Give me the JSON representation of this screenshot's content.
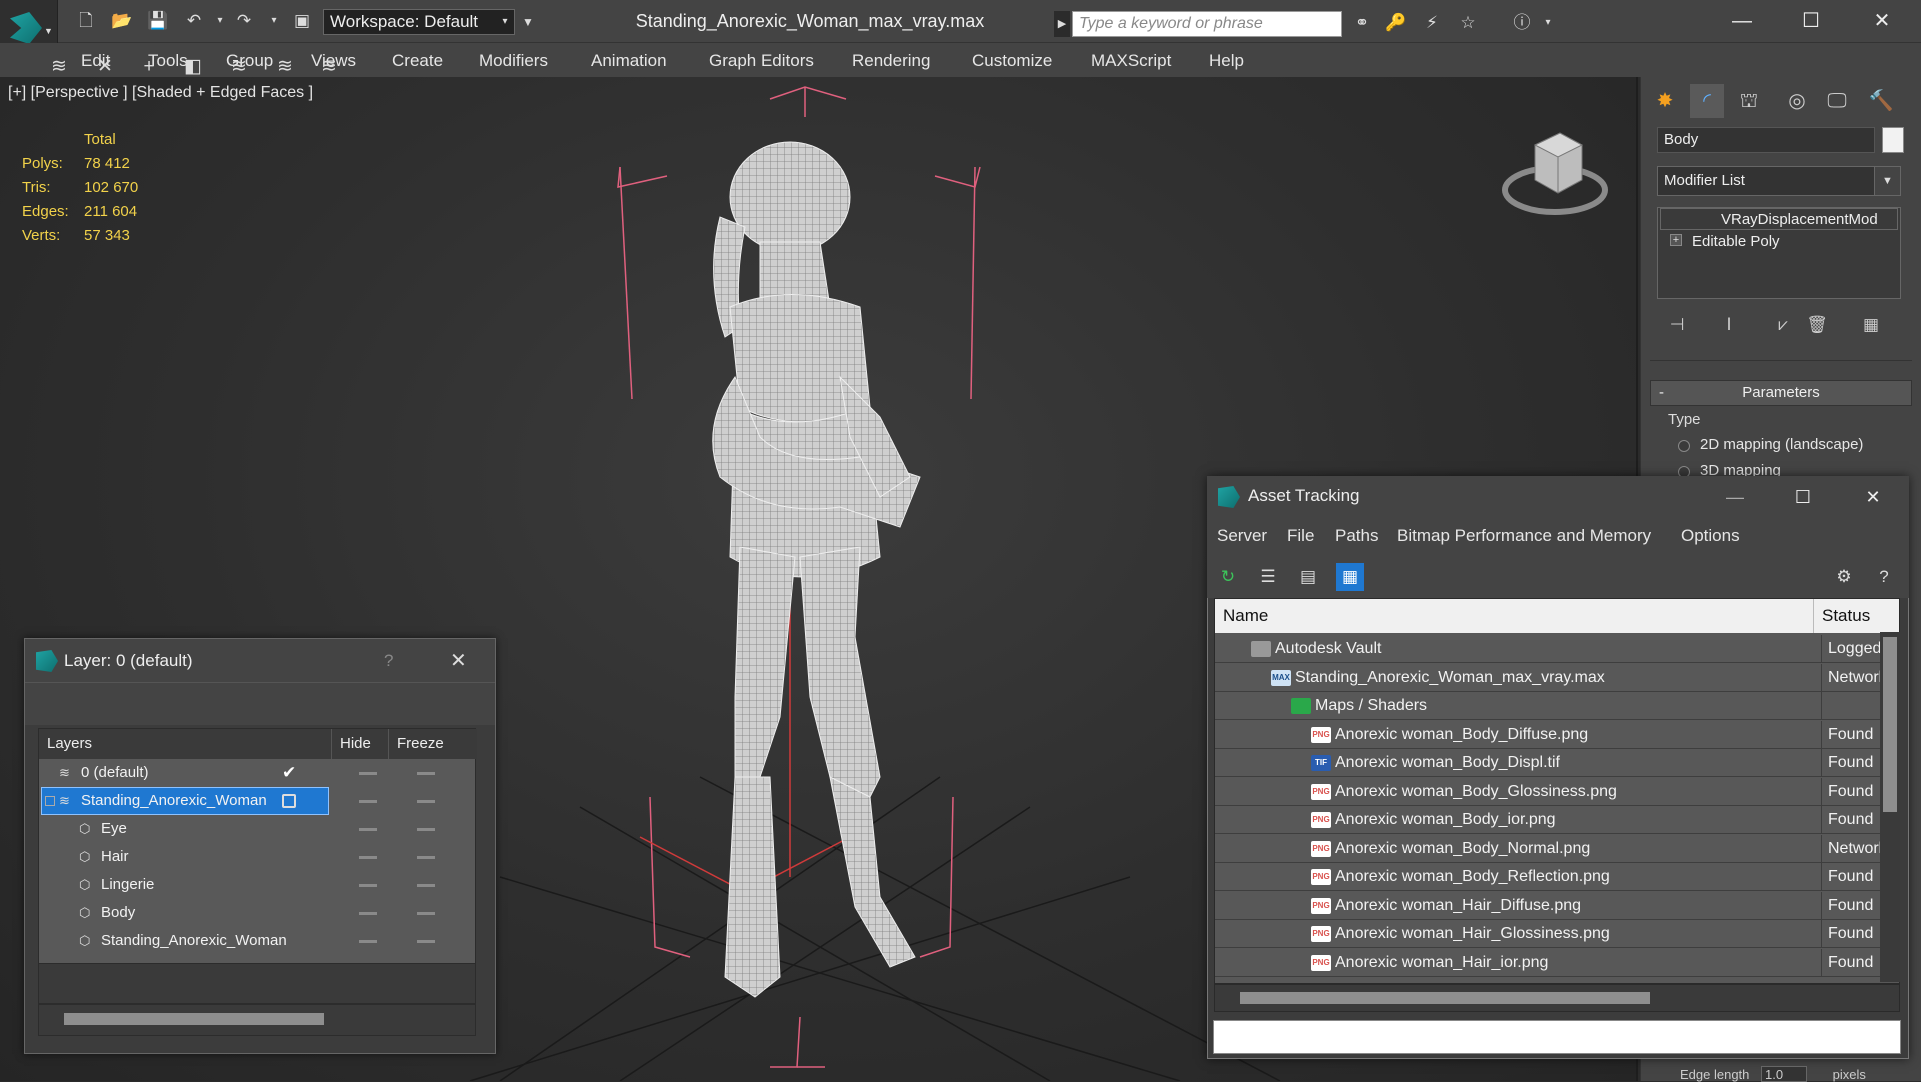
{
  "titlebar": {
    "workspace_label": "Workspace: Default",
    "document_title": "Standing_Anorexic_Woman_max_vray.max",
    "search_placeholder": "Type a keyword or phrase"
  },
  "menu": [
    "Edit",
    "Tools",
    "Group",
    "Views",
    "Create",
    "Modifiers",
    "Animation",
    "Graph Editors",
    "Rendering",
    "Customize",
    "MAXScript",
    "Help"
  ],
  "viewport": {
    "label": "[+] [Perspective ] [Shaded + Edged Faces ]",
    "stats": {
      "total_label": "Total",
      "rows": [
        {
          "label": "Polys:",
          "value": "78 412"
        },
        {
          "label": "Tris:",
          "value": "102 670"
        },
        {
          "label": "Edges:",
          "value": "211 604"
        },
        {
          "label": "Verts:",
          "value": "57 343"
        }
      ]
    }
  },
  "command_panel": {
    "object_name": "Body",
    "modifier_list_label": "Modifier List",
    "stack": [
      "VRayDisplacementMod",
      "Editable Poly"
    ],
    "rollout_title": "Parameters",
    "rollout_toggle": "-",
    "type_label": "Type",
    "type_options": [
      "2D mapping (landscape)",
      "3D mapping"
    ],
    "bottom_label": "Edge length",
    "bottom_value": "1.0",
    "bottom_unit": "pixels"
  },
  "layer_dialog": {
    "title": "Layer: 0 (default)",
    "help": "?",
    "columns": [
      "Layers",
      "Hide",
      "Freeze"
    ],
    "rows": [
      {
        "name": "0 (default)",
        "indent": 1,
        "type": "layer",
        "selected": false
      },
      {
        "name": "Standing_Anorexic_Woman",
        "indent": 1,
        "type": "layer",
        "selected": true
      },
      {
        "name": "Eye",
        "indent": 2,
        "type": "object",
        "selected": false
      },
      {
        "name": "Hair",
        "indent": 2,
        "type": "object",
        "selected": false
      },
      {
        "name": "Lingerie",
        "indent": 2,
        "type": "object",
        "selected": false
      },
      {
        "name": "Body",
        "indent": 2,
        "type": "object",
        "selected": false
      },
      {
        "name": "Standing_Anorexic_Woman",
        "indent": 2,
        "type": "object",
        "selected": false
      }
    ]
  },
  "asset_tracking": {
    "title": "Asset Tracking",
    "menu": [
      "Server",
      "File",
      "Paths",
      "Bitmap Performance and Memory",
      "Options"
    ],
    "columns": [
      "Name",
      "Status"
    ],
    "rows": [
      {
        "name": "Autodesk Vault",
        "indent": 0,
        "badge": "vault",
        "status": "Logged"
      },
      {
        "name": "Standing_Anorexic_Woman_max_vray.max",
        "indent": 1,
        "badge": "max",
        "status": "Network"
      },
      {
        "name": "Maps / Shaders",
        "indent": 2,
        "badge": "maps",
        "status": ""
      },
      {
        "name": "Anorexic woman_Body_Diffuse.png",
        "indent": 3,
        "badge": "PNG",
        "status": "Found"
      },
      {
        "name": "Anorexic woman_Body_Displ.tif",
        "indent": 3,
        "badge": "TIF",
        "status": "Found"
      },
      {
        "name": "Anorexic woman_Body_Glossiness.png",
        "indent": 3,
        "badge": "PNG",
        "status": "Found"
      },
      {
        "name": "Anorexic woman_Body_ior.png",
        "indent": 3,
        "badge": "PNG",
        "status": "Found"
      },
      {
        "name": "Anorexic woman_Body_Normal.png",
        "indent": 3,
        "badge": "PNG",
        "status": "Network"
      },
      {
        "name": "Anorexic woman_Body_Reflection.png",
        "indent": 3,
        "badge": "PNG",
        "status": "Found"
      },
      {
        "name": "Anorexic woman_Hair_Diffuse.png",
        "indent": 3,
        "badge": "PNG",
        "status": "Found"
      },
      {
        "name": "Anorexic woman_Hair_Glossiness.png",
        "indent": 3,
        "badge": "PNG",
        "status": "Found"
      },
      {
        "name": "Anorexic woman_Hair_ior.png",
        "indent": 3,
        "badge": "PNG",
        "status": "Found"
      }
    ]
  },
  "colors": {
    "accent": "#1f78d1",
    "stats_yellow": "#f2d24a",
    "bbox_pink": "#e0607e",
    "png_badge": "#d9534f",
    "tif_badge": "#2a5db0"
  }
}
